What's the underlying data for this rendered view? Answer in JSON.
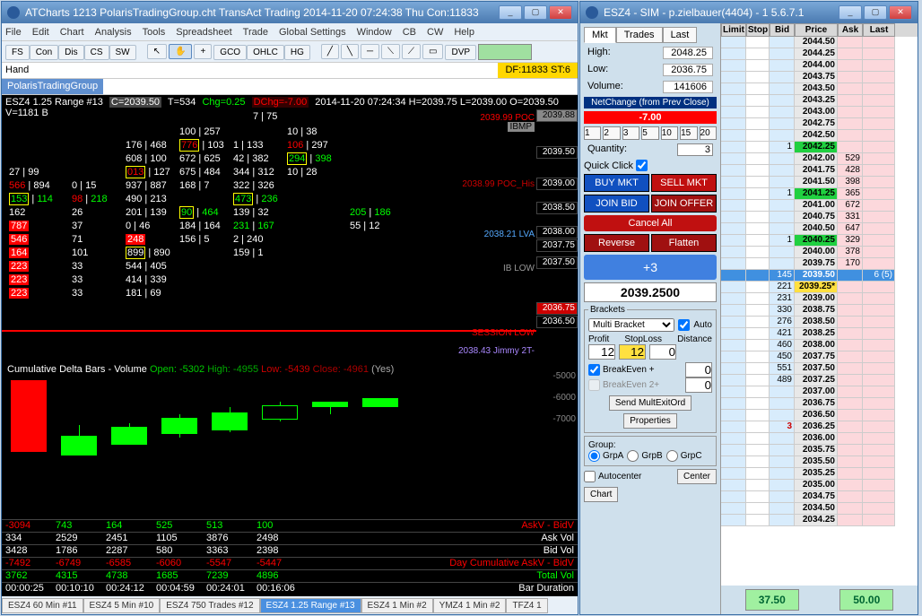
{
  "left": {
    "title": "ATCharts 1213 PolarisTradingGroup.cht  TransAct Trading 2014-11-20  07:24:38 Thu  Con:11833",
    "menu": [
      "File",
      "Edit",
      "Chart",
      "Analysis",
      "Tools",
      "Spreadsheet",
      "Trade",
      "Global Settings",
      "Window",
      "CB",
      "CW",
      "Help"
    ],
    "toolbar1": [
      "FS",
      "Con",
      "Dis",
      "CS",
      "SW"
    ],
    "toolbar2": [
      "GCO",
      "OHLC",
      "HG"
    ],
    "toolbar3": [
      "DVP"
    ],
    "info_label": "Hand",
    "info_status": "DF:11833  ST:6",
    "lookup": "PolarisTradingGroup",
    "chart_hdr": {
      "sym": "ESZ4 1.25 Range #13",
      "c": "C=2039.50",
      "t": "T=534",
      "chg": "Chg=0.25",
      "dchg": "DChg=-7.00",
      "ts": "2014-11-20 07:24:34 H=2039.75 L=2039.00 O=2039.50 V=1181 B"
    },
    "top_center": "7 | 75",
    "labels": {
      "poc": "2039.99 POC",
      "pochis": "2038.99 POC_His",
      "lva": "2038.21 LVA",
      "iblow": "IB LOW",
      "seslow": "SESSION LOW",
      "jimmy": "2038.43 Jimmy 2T-"
    },
    "prices": {
      "ibmp": "2039.88",
      "p1": "2039.50",
      "p2": "2039.00",
      "p3": "2038.50",
      "p4": "2038.00",
      "p5": "2037.75",
      "p6": "2037.50",
      "low": "2036.75",
      "p7": "2036.50"
    },
    "nbars": [
      [
        [
          "",
          ""
        ],
        [
          "",
          ""
        ],
        [
          "",
          ""
        ],
        [
          "100",
          "257",
          "w"
        ],
        [
          "",
          ""
        ],
        [
          "10",
          "38",
          "w"
        ],
        [
          "",
          ""
        ]
      ],
      [
        [
          "",
          ""
        ],
        [
          "",
          ""
        ],
        [
          "176",
          "468",
          "w"
        ],
        [
          "776",
          "103",
          "y r"
        ],
        [
          "1",
          "133",
          "w"
        ],
        [
          "106",
          "297",
          "r"
        ],
        [
          "",
          ""
        ]
      ],
      [
        [
          "",
          ""
        ],
        [
          "",
          ""
        ],
        [
          "608",
          "100",
          "w"
        ],
        [
          "672",
          "625",
          "w"
        ],
        [
          "42",
          "382",
          "w"
        ],
        [
          "294",
          "398",
          "y g"
        ],
        [
          "",
          ""
        ]
      ],
      [
        [
          "27",
          "99",
          "w"
        ],
        [
          "",
          ""
        ],
        [
          "013",
          "127",
          "y r"
        ],
        [
          "675",
          "484",
          "w"
        ],
        [
          "344",
          "312",
          "w"
        ],
        [
          "10",
          "28",
          "w"
        ],
        [
          "",
          ""
        ]
      ],
      [
        [
          "566",
          "894",
          "r w"
        ],
        [
          "0",
          "15",
          "w"
        ],
        [
          "937",
          "887",
          "w"
        ],
        [
          "168",
          "7",
          "w"
        ],
        [
          "322",
          "326",
          "w"
        ],
        [
          "",
          ""
        ],
        [
          "",
          ""
        ]
      ],
      [
        [
          "153",
          "114",
          "y g"
        ],
        [
          "98",
          "218",
          "r g"
        ],
        [
          "490",
          "213",
          "w"
        ],
        [
          "",
          ""
        ],
        [
          "473",
          "236",
          "y g"
        ],
        [
          "",
          ""
        ],
        [
          "",
          ""
        ]
      ],
      [
        [
          "162",
          "",
          "w"
        ],
        [
          "26",
          "",
          "w"
        ],
        [
          "201",
          "139",
          "w"
        ],
        [
          "90",
          "464",
          "y g"
        ],
        [
          "139",
          "32",
          "w"
        ],
        [
          "",
          ""
        ],
        [
          "205",
          "186",
          "w g"
        ]
      ],
      [
        [
          "787",
          "",
          "rbox"
        ],
        [
          "37",
          "",
          "w"
        ],
        [
          "0",
          "46",
          "w"
        ],
        [
          "184",
          "164",
          "w"
        ],
        [
          "231",
          "167",
          "w g"
        ],
        [
          "",
          ""
        ],
        [
          "55",
          "12",
          "w"
        ]
      ],
      [
        [
          "546",
          "",
          "rbox"
        ],
        [
          "71",
          "",
          "w"
        ],
        [
          "248",
          "",
          "rbox"
        ],
        [
          "156",
          "5",
          "w"
        ],
        [
          "2",
          "240",
          "w"
        ],
        [
          "",
          ""
        ],
        [
          "",
          ""
        ]
      ],
      [
        [
          "164",
          "",
          "y rbox"
        ],
        [
          "101",
          "",
          "w"
        ],
        [
          "899",
          "890",
          "y w"
        ],
        [
          "",
          ""
        ],
        [
          "159",
          "1",
          "w"
        ],
        [
          "",
          ""
        ],
        [
          "",
          ""
        ]
      ],
      [
        [
          "223",
          "",
          "rbox"
        ],
        [
          "33",
          "",
          "w"
        ],
        [
          "544",
          "405",
          "w"
        ],
        [
          "",
          ""
        ],
        [
          "",
          ""
        ],
        [
          "",
          ""
        ],
        [
          "",
          ""
        ]
      ],
      [
        [
          "223",
          "",
          "rbox"
        ],
        [
          "33",
          "",
          "w"
        ],
        [
          "414",
          "339",
          "w"
        ],
        [
          "",
          ""
        ],
        [
          "",
          ""
        ],
        [
          "",
          ""
        ],
        [
          "",
          ""
        ]
      ],
      [
        [
          "223",
          "",
          "rbox"
        ],
        [
          "33",
          "",
          "w"
        ],
        [
          "181",
          "69",
          "w"
        ],
        [
          "",
          ""
        ],
        [
          "",
          ""
        ],
        [
          "",
          ""
        ],
        [
          "",
          ""
        ]
      ]
    ],
    "delta_hdr": {
      "title": "Cumulative Delta Bars - Volume",
      "open": "Open: -5302",
      "high": "High: -4955",
      "low": "Low: -5439",
      "close": "Close: -4961",
      "yes": "(Yes)"
    },
    "delta_ticks": [
      "-5000",
      "-6000",
      "-7000"
    ],
    "table": {
      "rows": [
        {
          "cls": "rowr rowg-mix",
          "label": "AskV - BidV",
          "vals": [
            "-3094",
            "743",
            "164",
            "525",
            "513",
            "100"
          ],
          "colors": [
            "r",
            "g",
            "g",
            "g",
            "g",
            "g"
          ]
        },
        {
          "cls": "roww",
          "label": "Ask Vol",
          "vals": [
            "334",
            "2529",
            "2451",
            "1105",
            "3876",
            "2498"
          ],
          "colors": [
            "w",
            "w",
            "w",
            "w",
            "w",
            "w"
          ]
        },
        {
          "cls": "roww",
          "label": "Bid Vol",
          "vals": [
            "3428",
            "1786",
            "2287",
            "580",
            "3363",
            "2398"
          ],
          "colors": [
            "w",
            "w",
            "w",
            "w",
            "w",
            "w"
          ]
        },
        {
          "cls": "rowr",
          "label": "Day Cumulative AskV - BidV",
          "vals": [
            "-7492",
            "-6749",
            "-6585",
            "-6060",
            "-5547",
            "-5447"
          ],
          "colors": [
            "r",
            "r",
            "r",
            "r",
            "r",
            "r"
          ]
        },
        {
          "cls": "rowg",
          "label": "Total Vol",
          "vals": [
            "3762",
            "4315",
            "4738",
            "1685",
            "7239",
            "4896"
          ],
          "colors": [
            "g",
            "g",
            "g",
            "g",
            "g",
            "g"
          ]
        },
        {
          "cls": "roww",
          "label": "Bar Duration",
          "vals": [
            "00:00:25",
            "00:10:10",
            "00:24:12",
            "00:04:59",
            "00:24:01",
            "00:16:06"
          ],
          "colors": [
            "w",
            "w",
            "w",
            "w",
            "w",
            "w"
          ]
        }
      ]
    },
    "tabs": [
      "ESZ4 60 Min  #11",
      "ESZ4 5 Min  #10",
      "ESZ4 750 Trades  #12",
      "ESZ4 1.25 Range  #13",
      "ESZ4 1 Min  #2",
      "YMZ4 1 Min  #2",
      "TFZ4 1"
    ]
  },
  "right": {
    "title": "ESZ4 - SIM - p.zielbauer(4404) - 1 5.6.7.1",
    "tabs": [
      "Mkt",
      "Trades",
      "Last"
    ],
    "high_l": "High:",
    "high_v": "2048.25",
    "low_l": "Low:",
    "low_v": "2036.75",
    "vol_l": "Volume:",
    "vol_v": "141606",
    "nc_l": "NetChange (from Prev Close)",
    "nc_v": "-7.00",
    "sizes": [
      "1",
      "2",
      "3",
      "5",
      "10",
      "15",
      "20"
    ],
    "qty_l": "Quantity:",
    "qty_v": "3",
    "qc_l": "Quick Click",
    "buy": "BUY MKT",
    "sell": "SELL MKT",
    "jbid": "JOIN BID",
    "joffer": "JOIN OFFER",
    "cancel": "Cancel All",
    "reverse": "Reverse",
    "flatten": "Flatten",
    "plus3": "+3",
    "bigprice": "2039.2500",
    "brackets": "Brackets",
    "mb": "Multi Bracket",
    "auto": "Auto",
    "profit_l": "Profit",
    "sl_l": "StopLoss",
    "dist_l": "Distance",
    "profit_v": "12",
    "sl_v": "12",
    "dist_v": "0",
    "be1": "BreakEven +",
    "be2": "BreakEven 2+",
    "be1_v": "0",
    "be2_v": "0",
    "sendme": "Send MultExitOrd",
    "props": "Properties",
    "group": "Group:",
    "ga": "GrpA",
    "gb": "GrpB",
    "gc": "GrpC",
    "autocenter": "Autocenter",
    "center": "Center",
    "chart": "Chart",
    "hdr": [
      "Limit",
      "Stop",
      "Bid",
      "Price",
      "Ask",
      "Last"
    ],
    "rows": [
      {
        "p": "2044.50"
      },
      {
        "p": "2044.25"
      },
      {
        "p": "2044.00"
      },
      {
        "p": "2043.75"
      },
      {
        "p": "2043.50"
      },
      {
        "p": "2043.25"
      },
      {
        "p": "2043.00"
      },
      {
        "p": "2042.75"
      },
      {
        "p": "2042.50"
      },
      {
        "p": "2042.25",
        "bid": "1",
        "cls": "greenp"
      },
      {
        "p": "2042.00",
        "ask": "529"
      },
      {
        "p": "2041.75",
        "ask": "428"
      },
      {
        "p": "2041.50",
        "ask": "398"
      },
      {
        "p": "2041.25",
        "ask": "365",
        "bid": "1",
        "cls": "greenp"
      },
      {
        "p": "2041.00",
        "ask": "672"
      },
      {
        "p": "2040.75",
        "ask": "331"
      },
      {
        "p": "2040.50",
        "ask": "647"
      },
      {
        "p": "2040.25",
        "ask": "329",
        "bid": "1",
        "cls": "greenp"
      },
      {
        "p": "2040.00",
        "ask": "378"
      },
      {
        "p": "2039.75",
        "ask": "170"
      },
      {
        "p": "2039.50",
        "bid": "145",
        "last": "6 (5)",
        "cls": "bluep"
      },
      {
        "p": "2039.25*",
        "bid": "221",
        "cls": "yellowp"
      },
      {
        "p": "2039.00",
        "bid": "231"
      },
      {
        "p": "2038.75",
        "bid": "330"
      },
      {
        "p": "2038.50",
        "bid": "276"
      },
      {
        "p": "2038.25",
        "bid": "421"
      },
      {
        "p": "2038.00",
        "bid": "460"
      },
      {
        "p": "2037.75",
        "bid": "450"
      },
      {
        "p": "2037.50",
        "bid": "551"
      },
      {
        "p": "2037.25",
        "bid": "489"
      },
      {
        "p": "2037.00"
      },
      {
        "p": "2036.75"
      },
      {
        "p": "2036.50"
      },
      {
        "p": "2036.25",
        "bid": "3",
        "bidred": true
      },
      {
        "p": "2036.00"
      },
      {
        "p": "2035.75"
      },
      {
        "p": "2035.50"
      },
      {
        "p": "2035.25"
      },
      {
        "p": "2035.00"
      },
      {
        "p": "2034.75"
      },
      {
        "p": "2034.50"
      },
      {
        "p": "2034.25"
      }
    ],
    "foot1": "37.50",
    "foot2": "50.00"
  }
}
